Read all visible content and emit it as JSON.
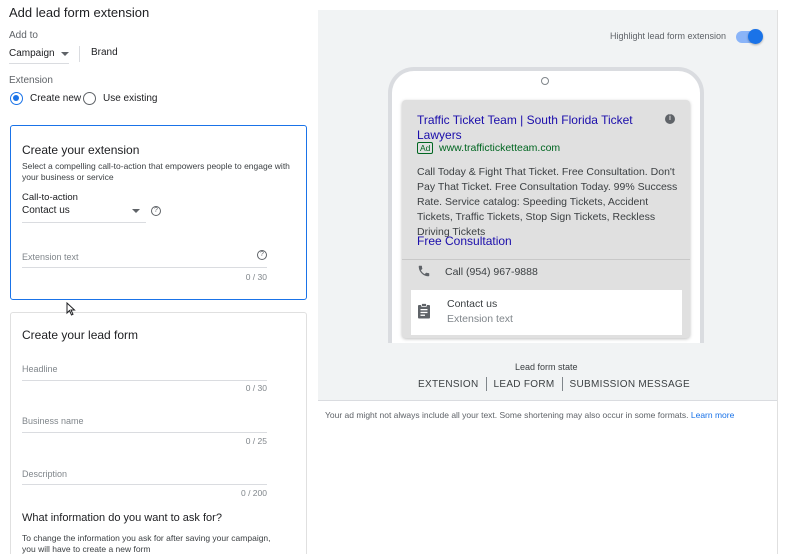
{
  "page_title": "Add lead form extension",
  "add_to": {
    "label": "Add to",
    "campaign_value": "Campaign",
    "brand": "Brand"
  },
  "extension": {
    "label": "Extension",
    "create_new": "Create new",
    "use_existing": "Use existing"
  },
  "create_extension": {
    "title": "Create your extension",
    "description": "Select a compelling call-to-action that empowers people to engage with your business or service",
    "cta_label": "Call-to-action",
    "cta_value": "Contact us",
    "text_label": "Extension text",
    "text_counter": "0 / 30"
  },
  "lead_form": {
    "title": "Create your lead form",
    "headline_label": "Headline",
    "headline_counter": "0 / 30",
    "business_label": "Business name",
    "business_counter": "0 / 25",
    "description_label": "Description",
    "description_counter": "0 / 200",
    "question_title": "What information do you want to ask for?",
    "question_note": "To change the information you ask for after saving your campaign, you will have to create a new form"
  },
  "preview": {
    "highlight_label": "Highlight lead form extension",
    "highlight_on": true,
    "ad_headline": "Traffic Ticket Team | South Florida Ticket Lawyers",
    "ad_badge": "Ad",
    "ad_url": "www.trafficticketteam.com",
    "ad_description": "Call Today & Fight That Ticket. Free Consultation. Don't Pay That Ticket. Free Consultation Today. 99% Success Rate. Service catalog: Speeding Tickets, Accident Tickets, Traffic Tickets, Stop Sign Tickets, Reckless Driving Tickets",
    "ad_sitelink": "Free Consultation",
    "call_text": "Call (954) 967-9888",
    "lead_title": "Contact us",
    "lead_sub": "Extension text"
  },
  "lead_form_state": {
    "label": "Lead form state",
    "tabs": [
      "EXTENSION",
      "LEAD FORM",
      "SUBMISSION MESSAGE"
    ]
  },
  "footnote": {
    "text": "Your ad might not always include all your text. Some shortening may also occur in some formats.",
    "link": "Learn more"
  },
  "colors": {
    "accent": "#1a73e8",
    "ad_link": "#1a0dab",
    "ad_url": "#006621"
  },
  "icons": [
    "caret-down-icon",
    "help-icon",
    "info-icon",
    "phone-icon",
    "clipboard-icon",
    "cursor-icon"
  ]
}
